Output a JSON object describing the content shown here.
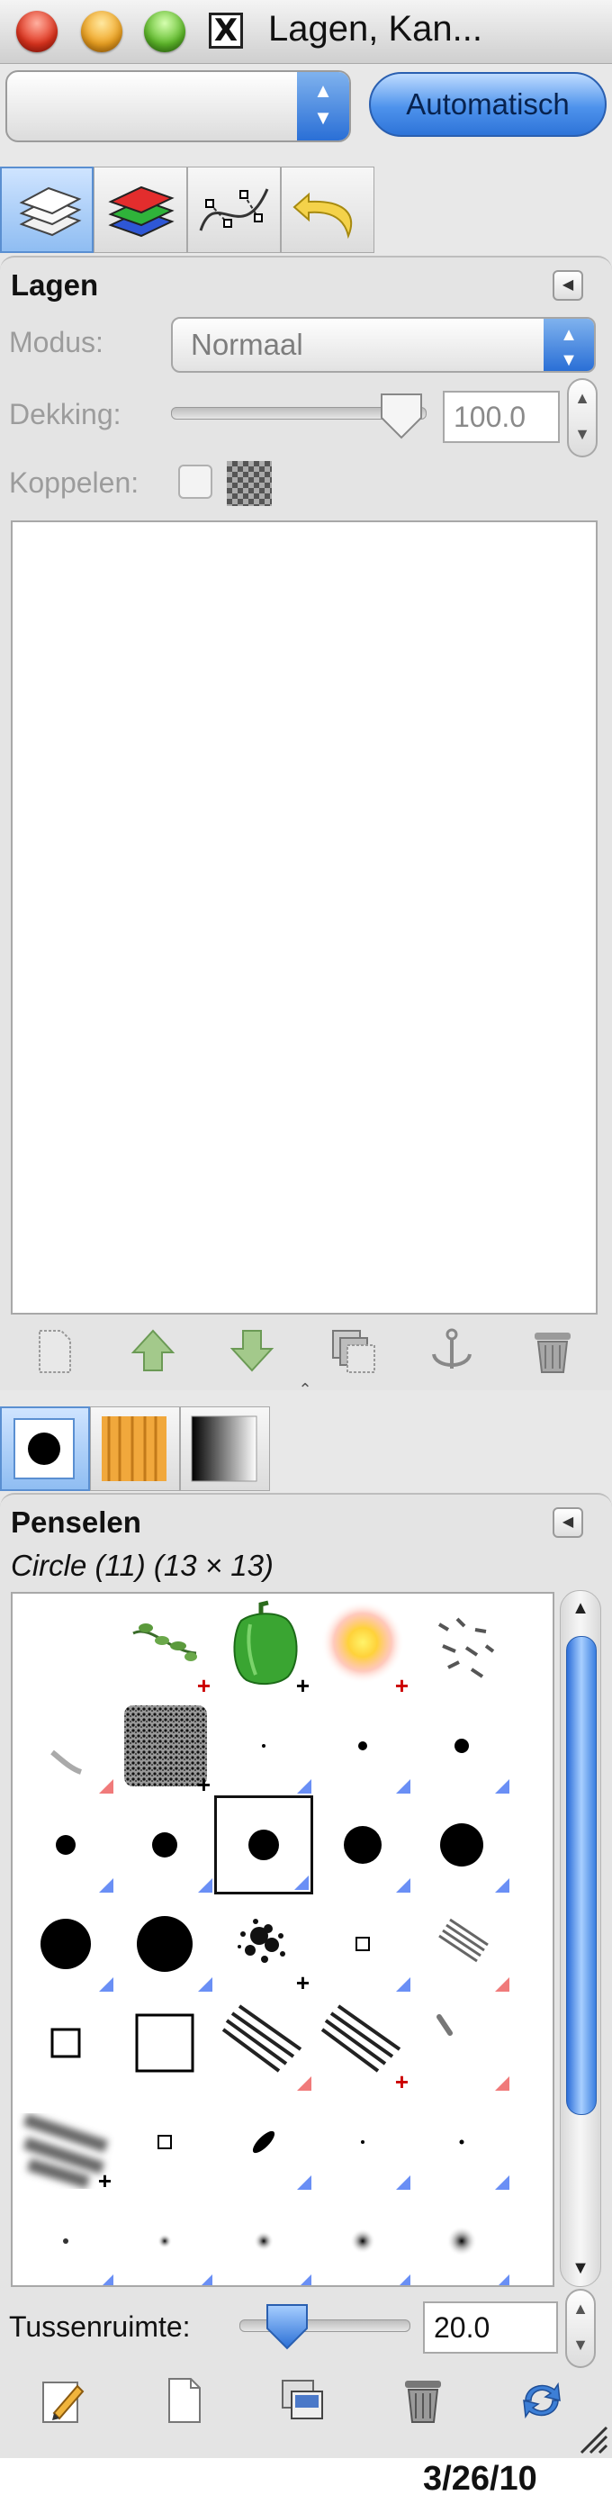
{
  "window": {
    "title": "Lagen, Kan...",
    "x_icon": "X"
  },
  "top": {
    "combo_value": "",
    "auto_button": "Automatisch"
  },
  "dock_tabs": [
    {
      "name": "layers-tab",
      "icon": "layers-icon",
      "active": true
    },
    {
      "name": "channels-tab",
      "icon": "channels-icon",
      "active": false
    },
    {
      "name": "paths-tab",
      "icon": "paths-icon",
      "active": false
    },
    {
      "name": "undo-history-tab",
      "icon": "undo-icon",
      "active": false
    }
  ],
  "layers": {
    "title": "Lagen",
    "mode_label": "Modus:",
    "mode_value": "Normaal",
    "opacity_label": "Dekking:",
    "opacity_value": "100.0",
    "opacity_fraction": 1.0,
    "link_label": "Koppelen:",
    "buttons": [
      "new-layer-icon",
      "raise-layer-icon",
      "lower-layer-icon",
      "duplicate-layer-icon",
      "anchor-layer-icon",
      "delete-layer-icon"
    ]
  },
  "lower_tabs": [
    {
      "name": "brushes-tab",
      "icon": "brush-icon",
      "active": true
    },
    {
      "name": "patterns-tab",
      "icon": "pattern-icon",
      "active": false
    },
    {
      "name": "gradients-tab",
      "icon": "gradient-icon",
      "active": false
    }
  ],
  "brushes": {
    "title": "Penselen",
    "selected": "Circle (11) (13 × 13)",
    "spacing_label": "Tussenruimte:",
    "spacing_value": "20.0",
    "spacing_fraction": 0.2,
    "buttons": [
      "edit-brush-icon",
      "new-brush-icon",
      "duplicate-brush-icon",
      "delete-brush-icon",
      "refresh-brushes-icon"
    ]
  },
  "colors": {
    "accent": "#2a6fd6",
    "panel": "#e4e4e4",
    "brush_marker_blue": "#6a8ff5",
    "brush_marker_red": "#f07a7a"
  },
  "footer": {
    "date": "3/26/10"
  }
}
